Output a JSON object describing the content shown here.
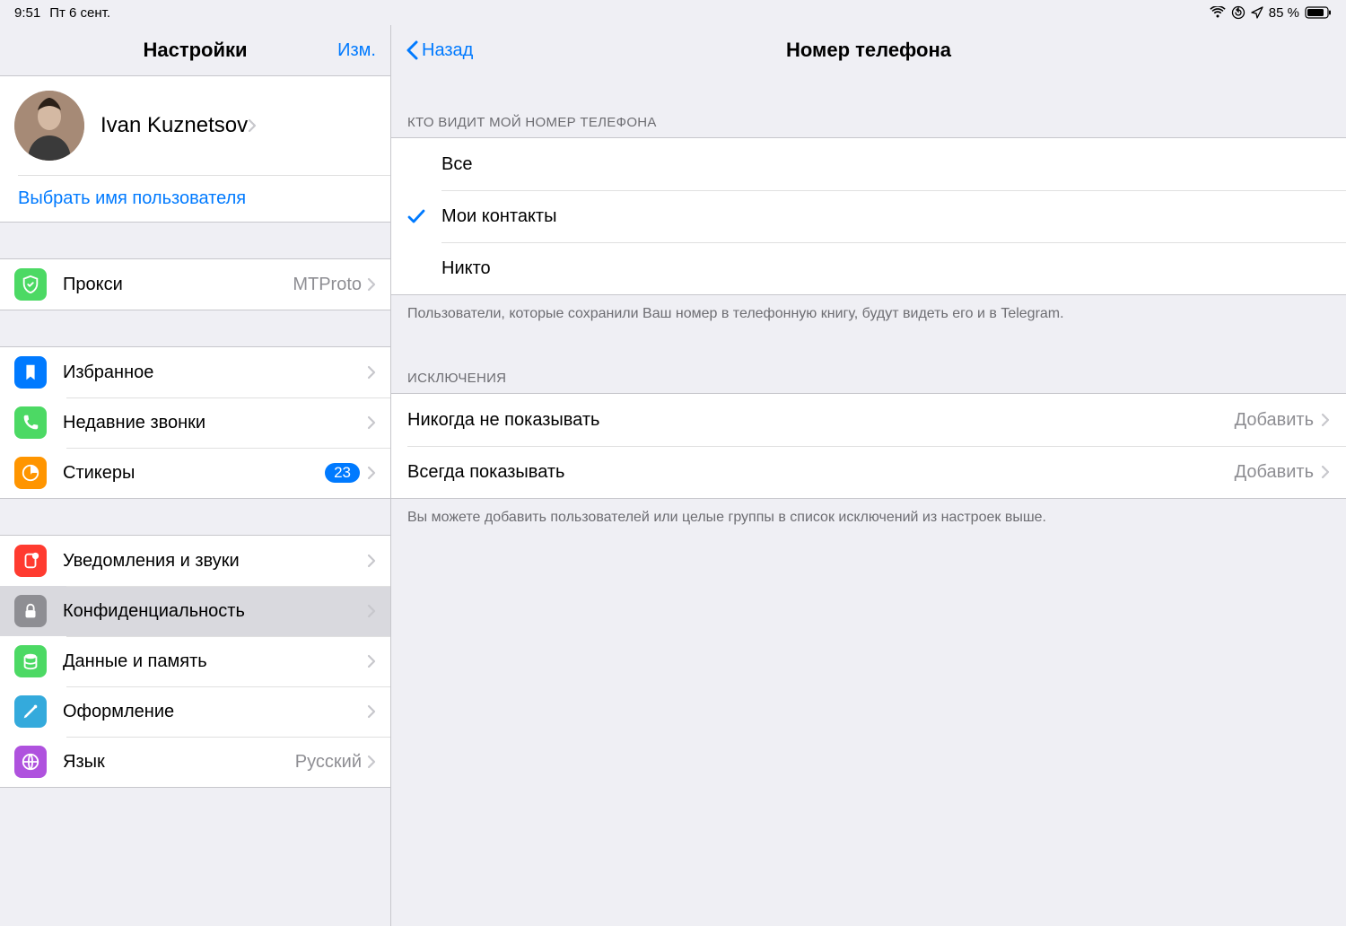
{
  "status": {
    "time": "9:51",
    "date": "Пт 6 сент.",
    "battery": "85 %"
  },
  "sidebar": {
    "title": "Настройки",
    "edit": "Изм.",
    "profile_name": "Ivan Kuznetsov",
    "username_link": "Выбрать имя пользователя",
    "proxy": {
      "label": "Прокси",
      "value": "MTProto"
    },
    "favorites": {
      "label": "Избранное"
    },
    "recent_calls": {
      "label": "Недавние звонки"
    },
    "stickers": {
      "label": "Стикеры",
      "badge": "23"
    },
    "notifications": {
      "label": "Уведомления и звуки"
    },
    "privacy": {
      "label": "Конфиденциальность"
    },
    "data": {
      "label": "Данные и память"
    },
    "appearance": {
      "label": "Оформление"
    },
    "language": {
      "label": "Язык",
      "value": "Русский"
    }
  },
  "detail": {
    "back": "Назад",
    "title": "Номер телефона",
    "visibility": {
      "header": "КТО ВИДИТ МОЙ НОМЕР ТЕЛЕФОНА",
      "options": {
        "everyone": "Все",
        "contacts": "Мои контакты",
        "nobody": "Никто"
      },
      "footer": "Пользователи, которые сохранили Ваш номер в телефонную книгу, будут видеть его и в Telegram."
    },
    "exceptions": {
      "header": "ИСКЛЮЧЕНИЯ",
      "never": {
        "label": "Никогда не показывать",
        "value": "Добавить"
      },
      "always": {
        "label": "Всегда показывать",
        "value": "Добавить"
      },
      "footer": "Вы можете добавить пользователей или целые группы в список исключений из настроек выше."
    }
  }
}
